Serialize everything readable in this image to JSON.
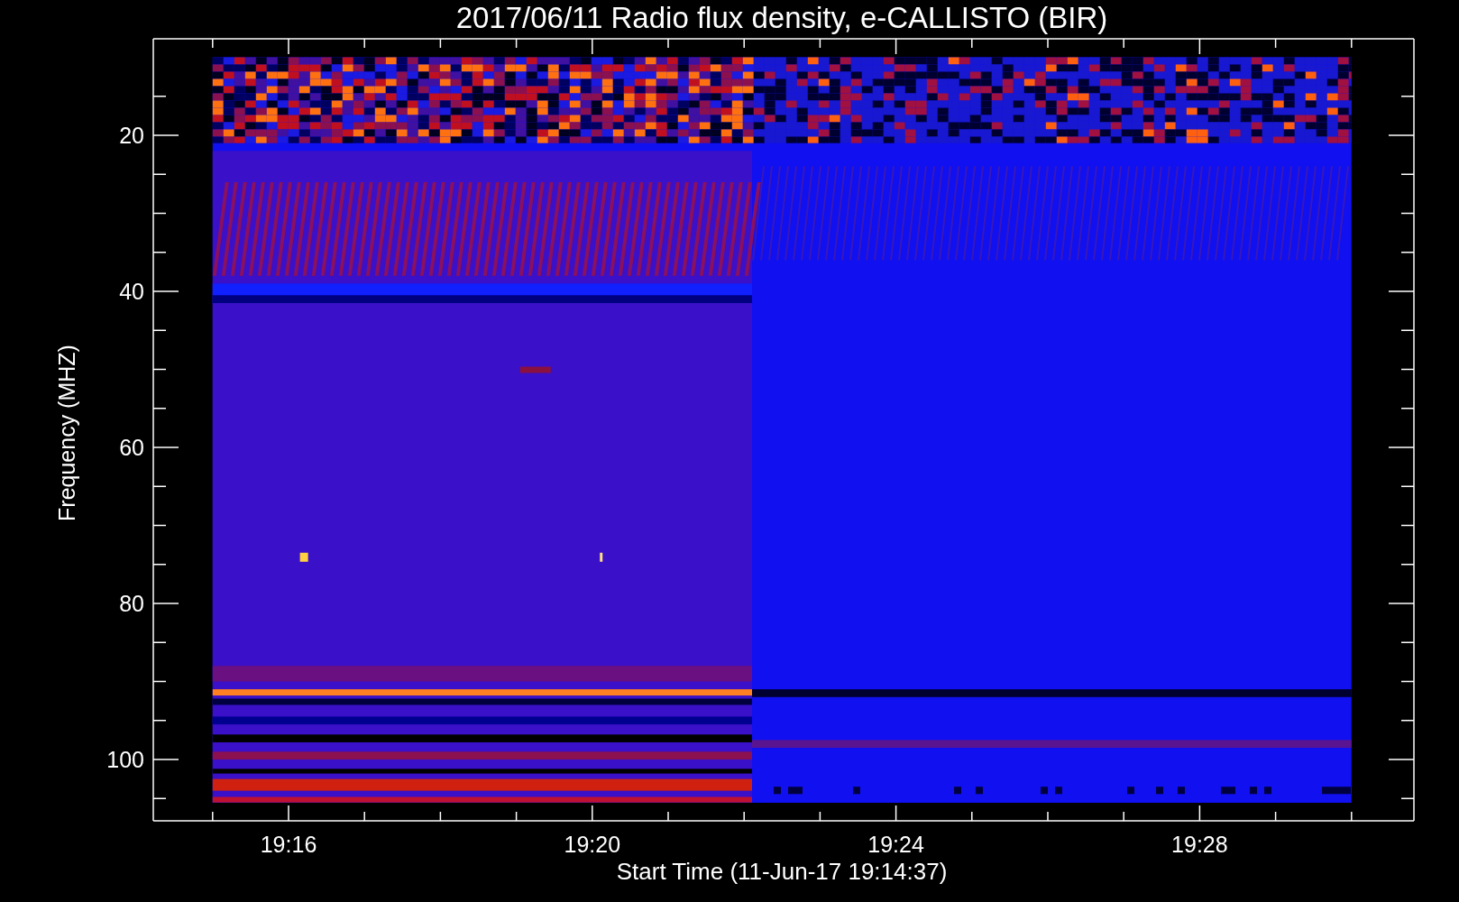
{
  "title": "2017/06/11  Radio flux density, e-CALLISTO (BIR)",
  "y_axis": {
    "label": "Frequency (MHZ)",
    "ticks": [
      "20",
      "40",
      "60",
      "80",
      "100"
    ]
  },
  "x_axis": {
    "label": "Start Time (11-Jun-17 19:14:37)",
    "ticks": [
      "19:16",
      "19:20",
      "19:24",
      "19:28"
    ]
  }
}
